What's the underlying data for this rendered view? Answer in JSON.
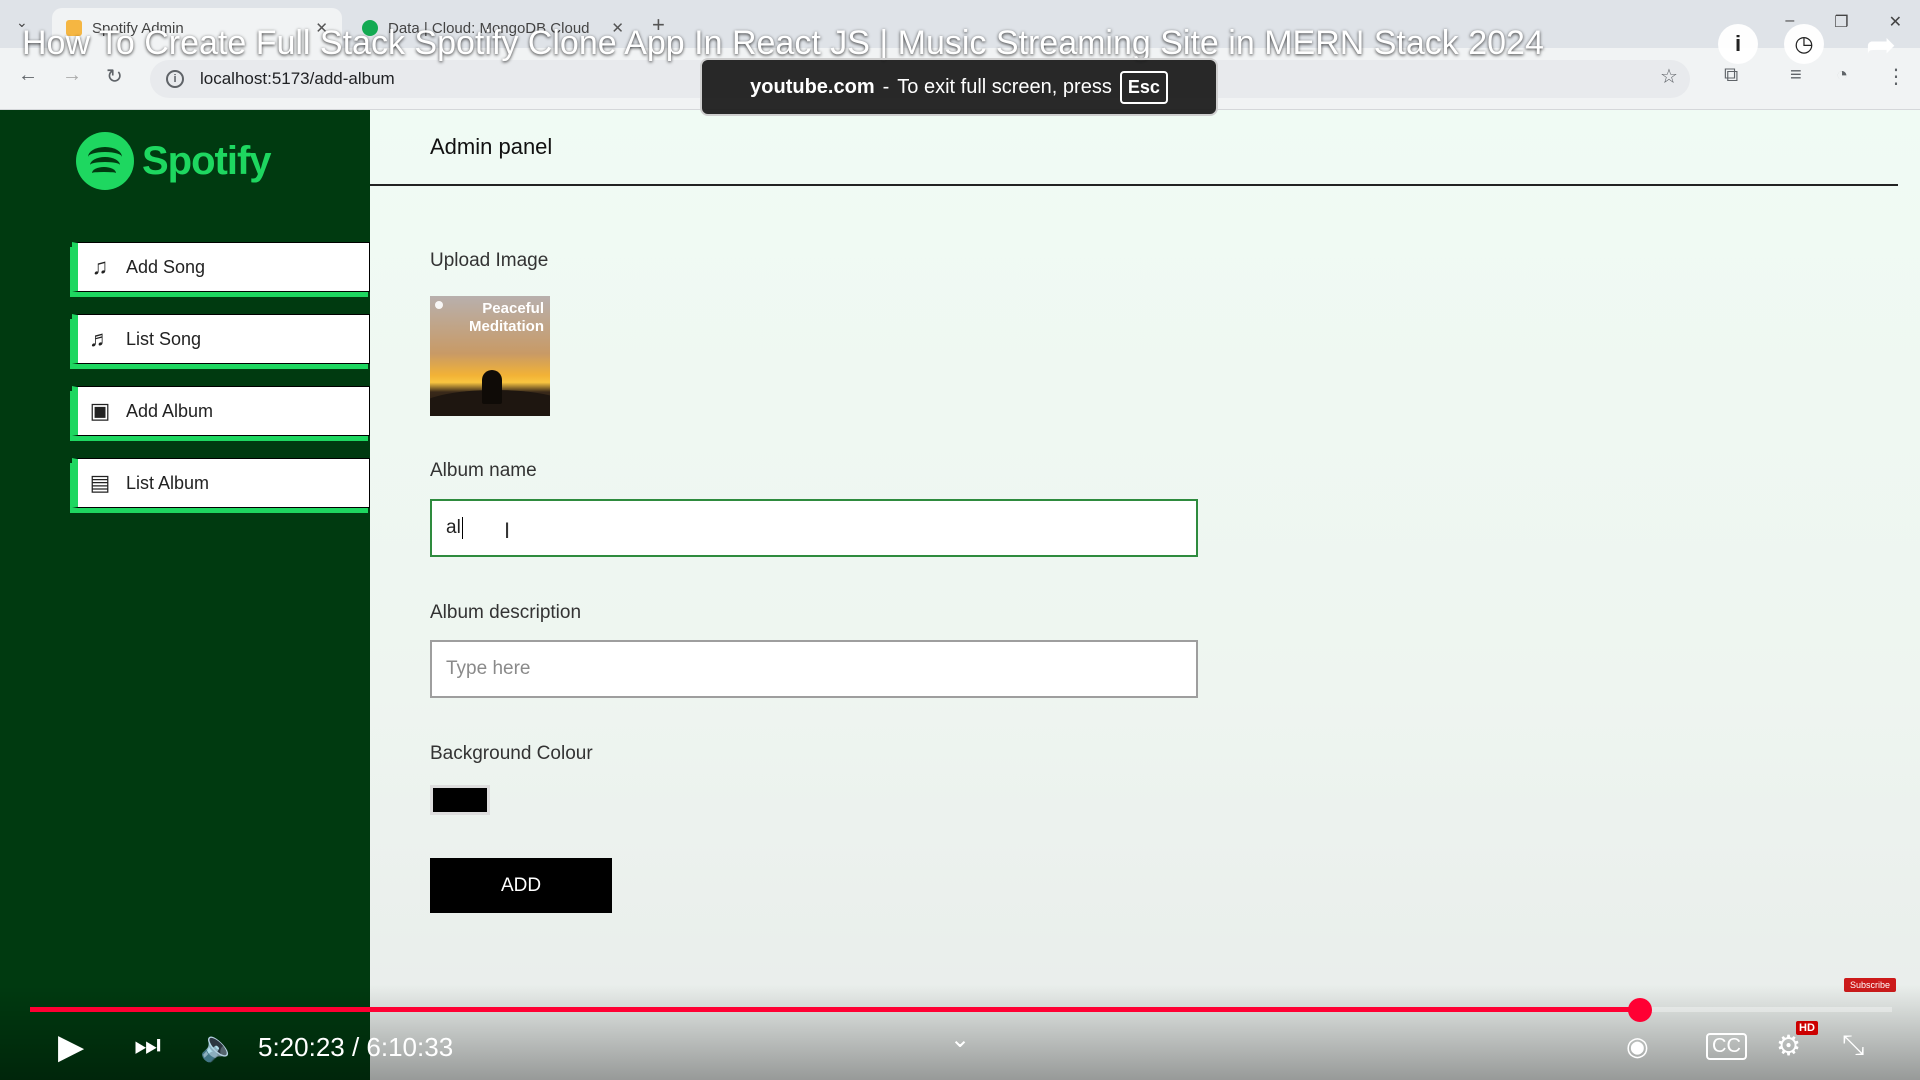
{
  "browser": {
    "tabs": [
      {
        "label": "Spotify Admin",
        "active": true,
        "favicon_color": "#f5b642"
      },
      {
        "label": "Data | Cloud: MongoDB Cloud",
        "active": false,
        "favicon_color": "#13aa52"
      }
    ],
    "url": "localhost:5173/add-album",
    "new_tab_label": "+"
  },
  "video": {
    "title": "How To Create Full Stack Spotify Clone App In React JS | Music Streaming Site in MERN Stack 2024",
    "fullscreen_notice": {
      "site": "youtube.com",
      "separator": "-",
      "message": "To exit full screen, press",
      "key": "Esc"
    },
    "time": "5:20:23 / 6:10:33",
    "progress_fraction": 0.8645,
    "subscribe_label": "Subscribe"
  },
  "sidebar": {
    "logo_text": "Spotify",
    "items": [
      {
        "label": "Add Song",
        "icon": "add-song-icon"
      },
      {
        "label": "List Song",
        "icon": "music-note-icon"
      },
      {
        "label": "Add Album",
        "icon": "add-album-icon"
      },
      {
        "label": "List Album",
        "icon": "album-icon"
      }
    ]
  },
  "main": {
    "header": "Admin panel",
    "upload_label": "Upload Image",
    "upload_preview_text": "Peaceful Meditation",
    "album_name_label": "Album name",
    "album_name_value": "al",
    "album_desc_label": "Album description",
    "album_desc_placeholder": "Type here",
    "bg_colour_label": "Background Colour",
    "bg_colour_value": "#000000",
    "add_button": "ADD"
  },
  "colors": {
    "sidebar_bg": "#003a10",
    "accent_green": "#1ed760",
    "youtube_red": "#ff0033"
  }
}
